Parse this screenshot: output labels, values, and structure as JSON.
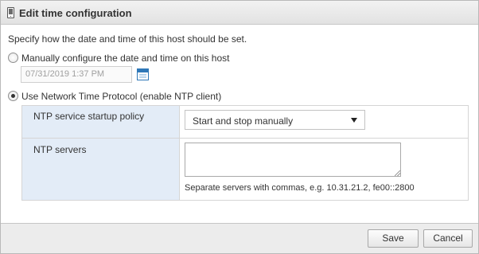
{
  "dialog": {
    "title": "Edit time configuration",
    "icon": "host-icon"
  },
  "intro_text": "Specify how the date and time of this host should be set.",
  "options": {
    "manual": {
      "label": "Manually configure the date and time on this host",
      "selected": false,
      "datetime_value": "07/31/2019 1:37 PM",
      "datetime_disabled": true,
      "calendar_icon": "calendar-icon"
    },
    "ntp": {
      "label": "Use Network Time Protocol (enable NTP client)",
      "selected": true
    }
  },
  "ntp_settings": {
    "startup_policy": {
      "label": "NTP service startup policy",
      "selected_value": "Start and stop manually"
    },
    "servers": {
      "label": "NTP servers",
      "value": "",
      "hint": "Separate servers with commas, e.g. 10.31.21.2, fe00::2800"
    }
  },
  "footer": {
    "save_label": "Save",
    "cancel_label": "Cancel"
  },
  "colors": {
    "label_cell_bg": "#e3ecf7",
    "accent": "#2f78b8",
    "footer_bg": "#ececec"
  }
}
